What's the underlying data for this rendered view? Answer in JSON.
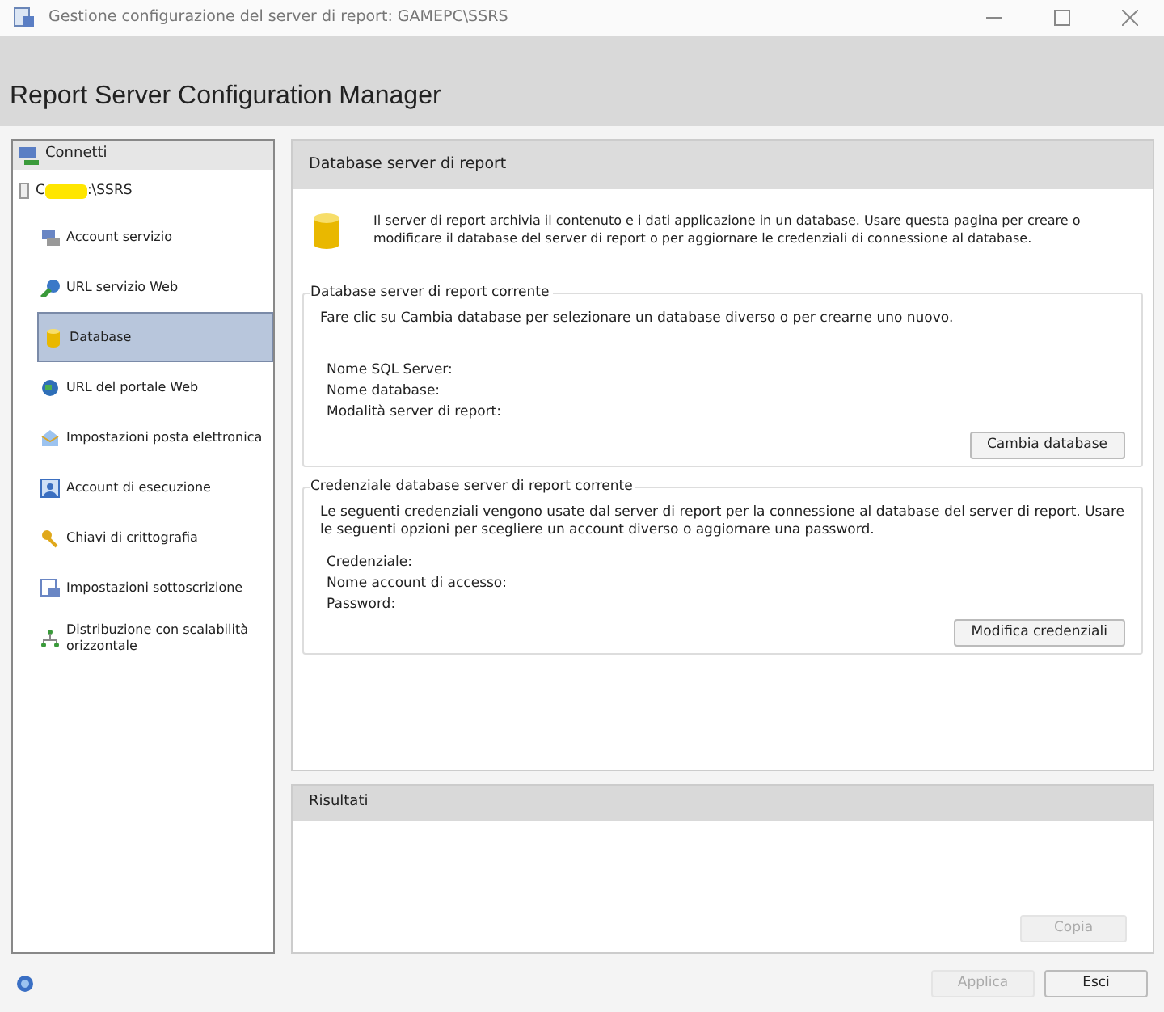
{
  "window": {
    "title": "Gestione configurazione del server di report: GAMEPC\\SSRS"
  },
  "header": {
    "title": "Report Server Configuration Manager"
  },
  "sidebar": {
    "connect": "Connetti",
    "server": {
      "prefix": "C",
      "suffix": ":\\SSRS",
      "redacted": true
    },
    "items": [
      {
        "label": "Account servizio",
        "kind": "account",
        "selected": false
      },
      {
        "label": "URL servizio Web",
        "kind": "webservice",
        "selected": false
      },
      {
        "label": "Database",
        "kind": "database",
        "selected": true
      },
      {
        "label": "URL del portale Web",
        "kind": "globe",
        "selected": false
      },
      {
        "label": "Impostazioni posta elettronica",
        "kind": "mail",
        "selected": false
      },
      {
        "label": "Account di esecuzione",
        "kind": "person",
        "selected": false
      },
      {
        "label": "Chiavi di crittografia",
        "kind": "keys",
        "selected": false
      },
      {
        "label": "Impostazioni sottoscrizione",
        "kind": "subscription",
        "selected": false
      },
      {
        "label": "Distribuzione con scalabilità orizzontale",
        "kind": "scaleout",
        "selected": false
      }
    ]
  },
  "page": {
    "title": "Database server di report",
    "intro": "Il server di report archivia il contenuto e i dati applicazione in un database. Usare questa pagina per creare o modificare il database del server di report o per aggiornare le credenziali di connessione al database.",
    "groups": [
      {
        "legend": "Database server di report corrente",
        "text": "Fare clic su Cambia database per selezionare un database diverso o per crearne uno nuovo.",
        "fields": [
          "Nome SQL Server:",
          "Nome database:",
          "Modalità server di report:"
        ],
        "button": {
          "label": "Cambia database",
          "disabled": false
        }
      },
      {
        "legend": "Credenziale database server di report corrente",
        "text": "Le seguenti credenziali vengono usate dal server di report per la connessione al database del server di report. Usare le seguenti opzioni per scegliere un account diverso o aggiornare una password.",
        "fields": [
          "Credenziale:",
          "Nome account di accesso:",
          "Password:"
        ],
        "button": {
          "label": "Modifica credenziali",
          "disabled": false
        }
      }
    ]
  },
  "results": {
    "title": "Risultati",
    "button": {
      "label": "Copia",
      "disabled": true
    }
  },
  "footer": {
    "buttons": [
      {
        "label": "Applica",
        "disabled": true
      },
      {
        "label": "Esci",
        "disabled": false
      }
    ]
  }
}
